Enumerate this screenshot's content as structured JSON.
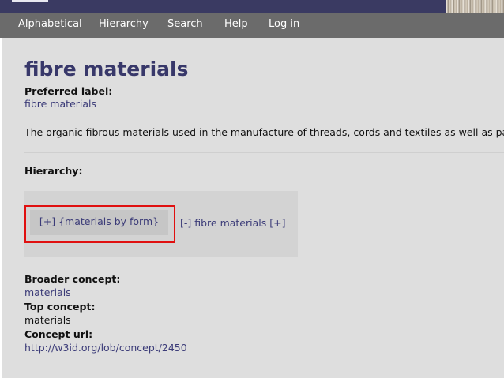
{
  "nav": {
    "items": [
      "Alphabetical",
      "Hierarchy",
      "Search",
      "Help",
      "Log in"
    ]
  },
  "concept": {
    "title": "fibre materials",
    "preferred_label_heading": "Preferred label:",
    "preferred_label": "fibre materials",
    "definition": "The organic fibrous materials used in the manufacture of threads, cords and textiles as well as paper.",
    "hierarchy_heading": "Hierarchy:",
    "hierarchy_parent": "[+] {materials by form}",
    "hierarchy_current": "[-] fibre materials [+]",
    "broader_heading": "Broader concept:",
    "broader": "materials",
    "top_heading": "Top concept:",
    "top": "materials",
    "url_heading": "Concept url:",
    "url": "http://w3id.org/lob/concept/2450"
  },
  "colors": {
    "header": "#3a3a62",
    "nav_bg": "#6b6b6b",
    "content_bg": "#dedede",
    "title": "#38386a",
    "link": "#3b3b78",
    "highlight": "#e01010"
  }
}
